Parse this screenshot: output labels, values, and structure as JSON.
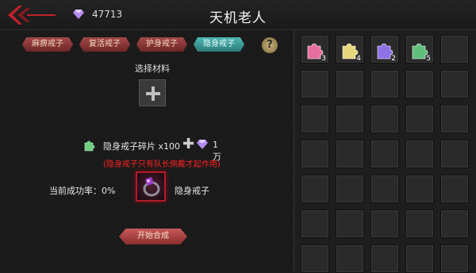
{
  "header": {
    "title": "天机老人",
    "gem_count": "47713"
  },
  "tabs": [
    {
      "label": "麻痹戒子",
      "active": false
    },
    {
      "label": "复活戒子",
      "active": false
    },
    {
      "label": "护身戒子",
      "active": false
    },
    {
      "label": "隐身戒子",
      "active": true
    }
  ],
  "help_label": "?",
  "craft": {
    "select_label": "选择材料",
    "material_name": "隐身戒子碎片 x100",
    "cost_value": "1万",
    "note": "(隐身戒子只有队长佩戴才起作用)",
    "success_rate_label": "当前成功率：0%",
    "result_name": "隐身戒子",
    "synth_button": "开始合成"
  },
  "inventory": [
    {
      "color": "#e76fa0",
      "count": "3"
    },
    {
      "color": "#e6d87a",
      "count": "4"
    },
    {
      "color": "#8d72e8",
      "count": "2"
    },
    {
      "color": "#5fc07a",
      "count": "5"
    }
  ],
  "colors": {
    "tab_red": "#a34848",
    "tab_active": "#4fb7b2",
    "note_red": "#ff2222"
  }
}
